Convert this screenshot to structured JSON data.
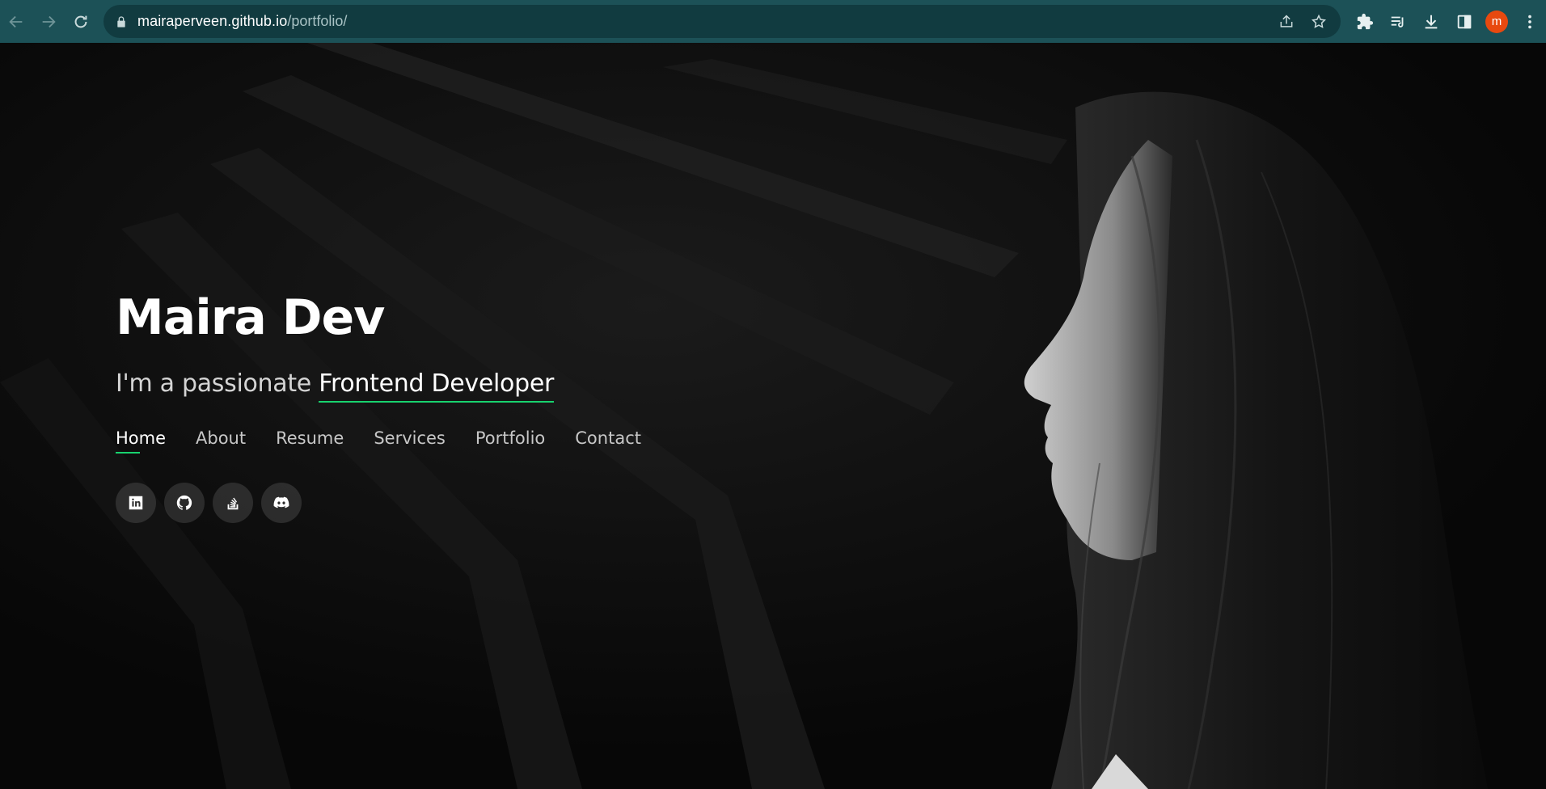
{
  "browser": {
    "url_host": "mairaperveen.github.io",
    "url_path": "/portfolio/",
    "avatar_letter": "m",
    "avatar_color": "#e8490f",
    "chrome_color": "#1c5157"
  },
  "hero": {
    "name": "Maira Dev",
    "tagline_prefix": "I'm a passionate ",
    "tagline_typed": "Frontend Developer",
    "accent_color": "#18d26e"
  },
  "nav": {
    "items": [
      {
        "label": "Home",
        "active": true
      },
      {
        "label": "About"
      },
      {
        "label": "Resume"
      },
      {
        "label": "Services"
      },
      {
        "label": "Portfolio"
      },
      {
        "label": "Contact"
      }
    ]
  },
  "socials": [
    {
      "icon": "linkedin-icon"
    },
    {
      "icon": "github-icon"
    },
    {
      "icon": "stackoverflow-icon"
    },
    {
      "icon": "discord-icon"
    }
  ]
}
